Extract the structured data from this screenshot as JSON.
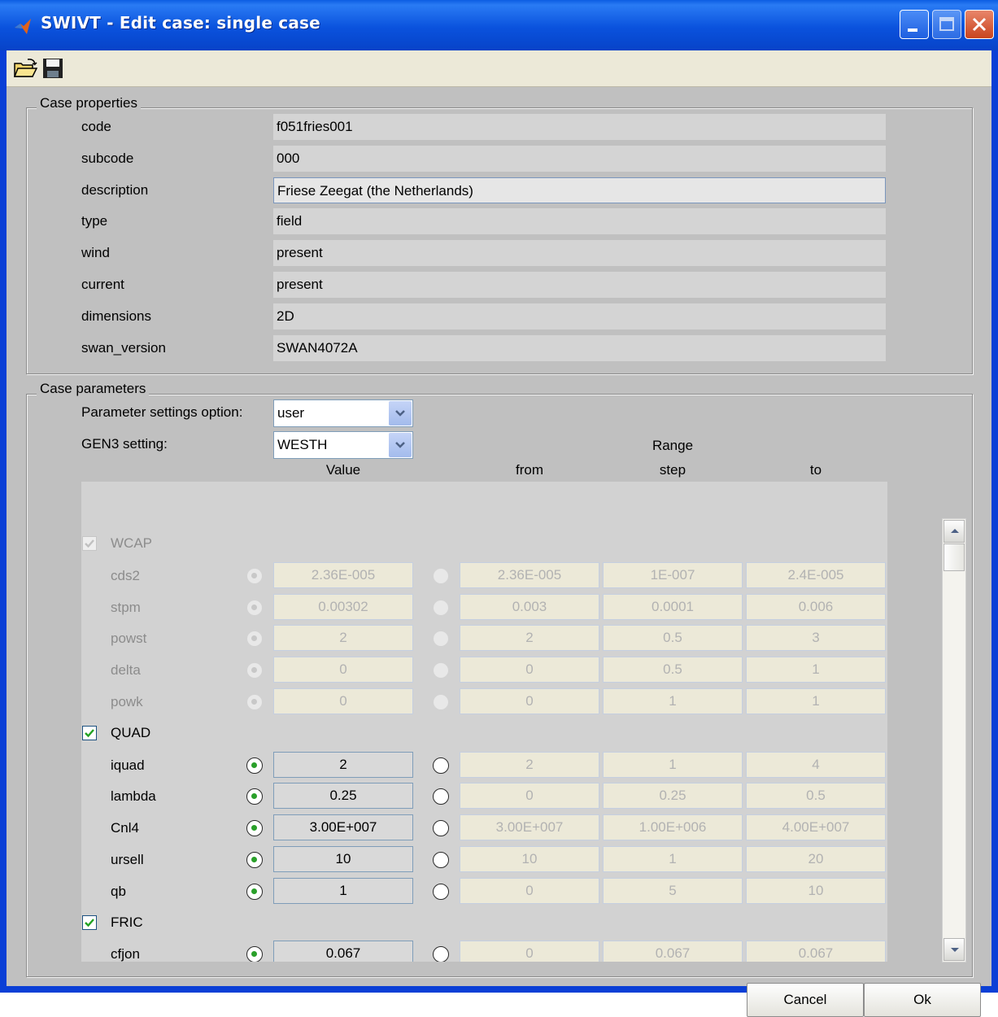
{
  "window": {
    "title": "SWIVT - Edit case: single case"
  },
  "toolbar": {
    "icons": [
      "open-folder-icon",
      "save-disk-icon"
    ]
  },
  "case_properties": {
    "group_title": "Case properties",
    "rows": [
      {
        "label": "code",
        "value": "f051fries001"
      },
      {
        "label": "subcode",
        "value": "000"
      },
      {
        "label": "description",
        "value": "Friese Zeegat (the Netherlands)"
      },
      {
        "label": "type",
        "value": "field"
      },
      {
        "label": "wind",
        "value": "present"
      },
      {
        "label": "current",
        "value": "present"
      },
      {
        "label": "dimensions",
        "value": "2D"
      },
      {
        "label": "swan_version",
        "value": "SWAN4072A"
      }
    ]
  },
  "case_parameters": {
    "group_title": "Case parameters",
    "param_option_label": "Parameter settings option:",
    "param_option_value": "user",
    "gen3_label": "GEN3 setting:",
    "gen3_value": "WESTH",
    "headers": {
      "range": "Range",
      "value": "Value",
      "from": "from",
      "step": "step",
      "to": "to"
    },
    "sections": [
      {
        "name": "WCAP",
        "checked": true,
        "enabled": false,
        "params": [
          {
            "name": "cds2",
            "value": "2.36E-005",
            "from": "2.36E-005",
            "step": "1E-007",
            "to": "2.4E-005"
          },
          {
            "name": "stpm",
            "value": "0.00302",
            "from": "0.003",
            "step": "0.0001",
            "to": "0.006"
          },
          {
            "name": "powst",
            "value": "2",
            "from": "2",
            "step": "0.5",
            "to": "3"
          },
          {
            "name": "delta",
            "value": "0",
            "from": "0",
            "step": "0.5",
            "to": "1"
          },
          {
            "name": "powk",
            "value": "0",
            "from": "0",
            "step": "1",
            "to": "1"
          }
        ]
      },
      {
        "name": "QUAD",
        "checked": true,
        "enabled": true,
        "params": [
          {
            "name": "iquad",
            "value": "2",
            "from": "2",
            "step": "1",
            "to": "4"
          },
          {
            "name": "lambda",
            "value": "0.25",
            "from": "0",
            "step": "0.25",
            "to": "0.5"
          },
          {
            "name": "Cnl4",
            "value": "3.00E+007",
            "from": "3.00E+007",
            "step": "1.00E+006",
            "to": "4.00E+007"
          },
          {
            "name": "ursell",
            "value": "10",
            "from": "10",
            "step": "1",
            "to": "20"
          },
          {
            "name": "qb",
            "value": "1",
            "from": "0",
            "step": "5",
            "to": "10"
          }
        ]
      },
      {
        "name": "FRIC",
        "checked": true,
        "enabled": true,
        "params": [
          {
            "name": "cfjon",
            "value": "0.067",
            "from": "0",
            "step": "0.067",
            "to": "0.067"
          }
        ]
      }
    ]
  },
  "buttons": {
    "cancel": "Cancel",
    "ok": "Ok"
  }
}
